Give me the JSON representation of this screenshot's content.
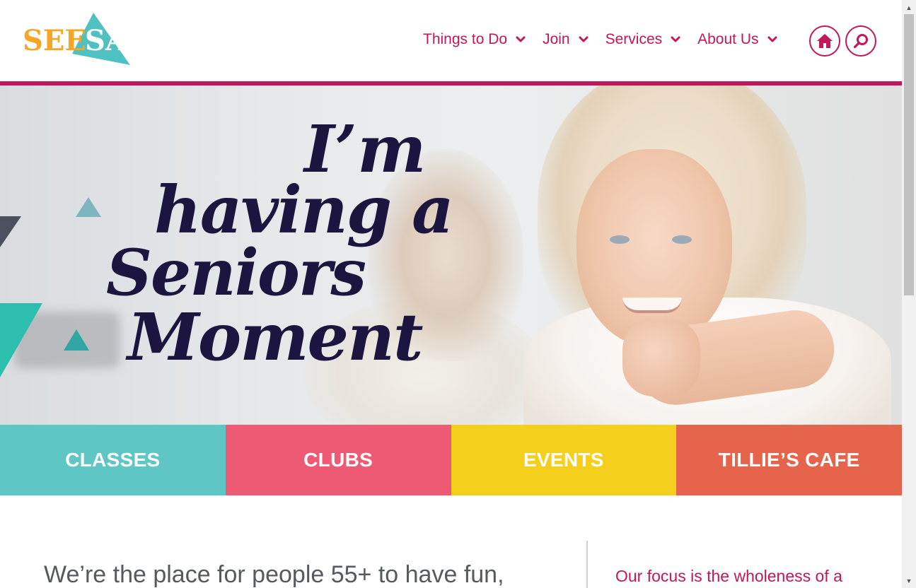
{
  "logo": {
    "part1": "SEE",
    "part2": "SA",
    "color_primary": "#f5a623",
    "color_accent": "#4fc1c0"
  },
  "nav": {
    "items": [
      {
        "label": "Things to Do",
        "icon": "chevron-down-icon"
      },
      {
        "label": "Join",
        "icon": "chevron-down-icon"
      },
      {
        "label": "Services",
        "icon": "chevron-down-icon"
      },
      {
        "label": "About Us",
        "icon": "chevron-down-icon"
      }
    ],
    "home_icon": "home-icon",
    "search_icon": "search-icon",
    "accent_color": "#c4165a"
  },
  "hero": {
    "line1": "I’m",
    "line2": "having a",
    "line3": "Seniors",
    "line4": "Moment",
    "text_color": "#1c1540"
  },
  "tiles": [
    {
      "label": "CLASSES",
      "color": "#5ec6c4"
    },
    {
      "label": "CLUBS",
      "color": "#ee5a73"
    },
    {
      "label": "EVENTS",
      "color": "#f4d01c"
    },
    {
      "label": "TILLIE’S CAFE",
      "color": "#e5644b"
    }
  ],
  "content": {
    "intro": "We’re the place for people 55+ to have fun,",
    "focus": "Our focus is the wholeness of a"
  },
  "scrollbar": {
    "up_icon": "scroll-up-arrow-icon",
    "down_icon": "scroll-down-arrow-icon"
  }
}
